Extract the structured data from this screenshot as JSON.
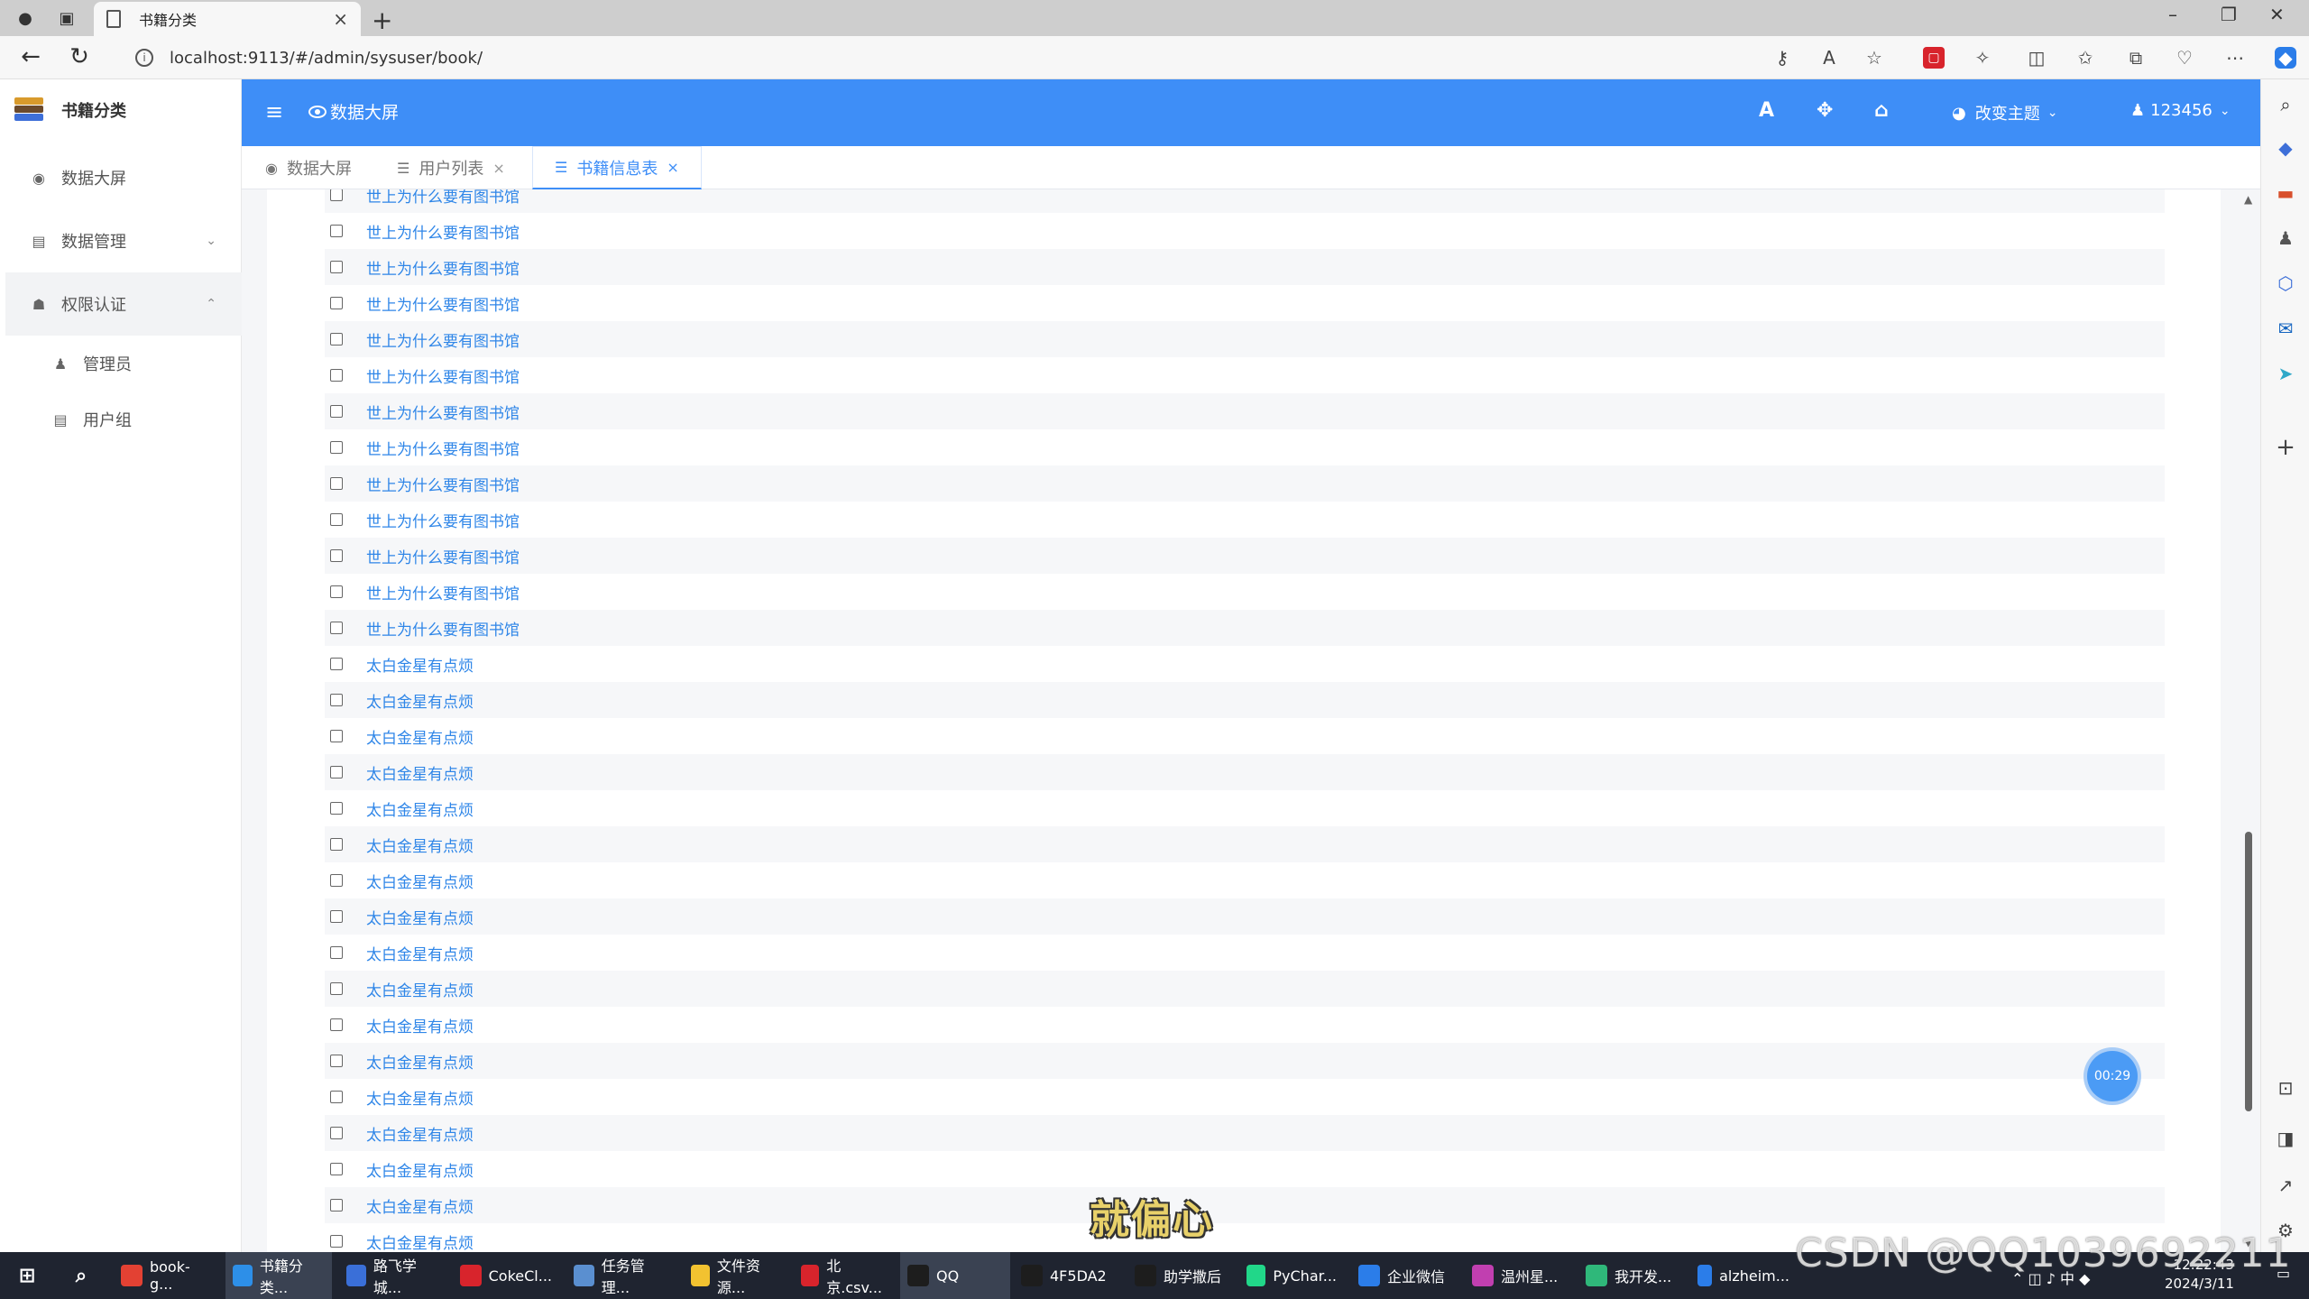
{
  "browser": {
    "tab_title": "书籍分类",
    "tab_close": "×",
    "new_tab": "+",
    "url": "localhost:9113/#/admin/sysuser/book/",
    "win_minimize": "–",
    "win_restore": "❐",
    "win_close": "✕"
  },
  "sidebar": {
    "logo_text": "书籍分类",
    "items": [
      {
        "label": "数据大屏",
        "icon": "eye-icon"
      },
      {
        "label": "数据管理",
        "icon": "table-icon",
        "arrow": "⌄"
      },
      {
        "label": "权限认证",
        "icon": "user-lock-icon",
        "arrow": "⌃"
      }
    ],
    "subitems": [
      {
        "label": "管理员",
        "icon": "user-icon"
      },
      {
        "label": "用户组",
        "icon": "table-icon"
      }
    ]
  },
  "header": {
    "title": "数据大屏",
    "theme_label": "改变主题",
    "user_label": "123456",
    "font_icon": "A",
    "bg_color": "#3e8ef7"
  },
  "tabs": [
    {
      "label": "数据大屏",
      "closable": false,
      "active": false
    },
    {
      "label": "用户列表",
      "closable": true,
      "active": false
    },
    {
      "label": "书籍信息表",
      "closable": true,
      "active": true
    }
  ],
  "list_rows": [
    "世上为什么要有图书馆",
    "世上为什么要有图书馆",
    "世上为什么要有图书馆",
    "世上为什么要有图书馆",
    "世上为什么要有图书馆",
    "世上为什么要有图书馆",
    "世上为什么要有图书馆",
    "世上为什么要有图书馆",
    "世上为什么要有图书馆",
    "世上为什么要有图书馆",
    "世上为什么要有图书馆",
    "世上为什么要有图书馆",
    "世上为什么要有图书馆",
    "太白金星有点烦",
    "太白金星有点烦",
    "太白金星有点烦",
    "太白金星有点烦",
    "太白金星有点烦",
    "太白金星有点烦",
    "太白金星有点烦",
    "太白金星有点烦",
    "太白金星有点烦",
    "太白金星有点烦",
    "太白金星有点烦",
    "太白金星有点烦",
    "太白金星有点烦",
    "太白金星有点烦",
    "太白金星有点烦",
    "太白金星有点烦",
    "太白金星有点烦"
  ],
  "timer": "00:29",
  "subtitle": "就偏心",
  "watermark": "CSDN @QQ1039692211",
  "taskbar": {
    "items": [
      {
        "label": "book-g...",
        "color": "#e34133"
      },
      {
        "label": "书籍分类...",
        "color": "#2d8fe8"
      },
      {
        "label": "路飞学城...",
        "color": "#3a6fd8"
      },
      {
        "label": "CokeCl...",
        "color": "#d8242c"
      },
      {
        "label": "任务管理...",
        "color": "#5a8fd0"
      },
      {
        "label": "文件资源...",
        "color": "#f2c230"
      },
      {
        "label": "北京.csv...",
        "color": "#d8242c"
      },
      {
        "label": "QQ",
        "color": "#1d1d1d"
      },
      {
        "label": "4F5DA2",
        "color": "#1d1d1d"
      },
      {
        "label": "助学撒后",
        "color": "#1d1d1d"
      },
      {
        "label": "PyChar...",
        "color": "#21d789"
      },
      {
        "label": "企业微信",
        "color": "#2b7de9"
      },
      {
        "label": "温州星...",
        "color": "#c13fb0"
      },
      {
        "label": "我开发...",
        "color": "#2fb87a"
      },
      {
        "label": "alzheim...",
        "color": "#2b7de9"
      }
    ],
    "time": "12:22:43",
    "date": "2024/3/11"
  }
}
